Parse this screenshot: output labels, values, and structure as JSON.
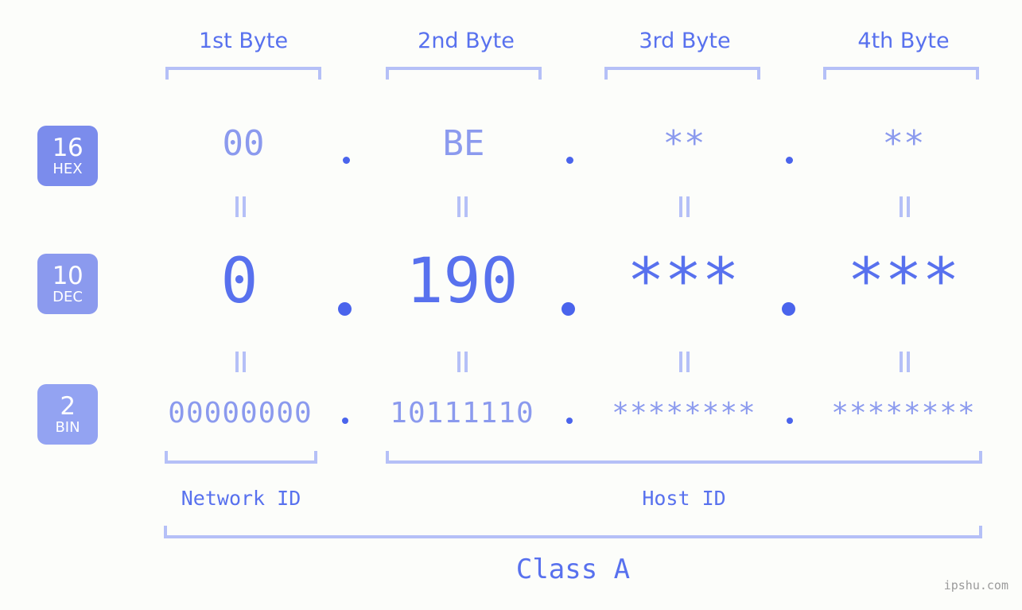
{
  "meta": {
    "watermark": "ipshu.com",
    "background_color": "#fcfdfa",
    "accent_strong": "#5871ee",
    "accent_light": "#8b9aee",
    "bracket_color": "#b5c0f7"
  },
  "byte_headers": [
    {
      "label": "1st Byte"
    },
    {
      "label": "2nd Byte"
    },
    {
      "label": "3rd Byte"
    },
    {
      "label": "4th Byte"
    }
  ],
  "bases": [
    {
      "number": "16",
      "name": "HEX",
      "color": "#7b8cec"
    },
    {
      "number": "10",
      "name": "DEC",
      "color": "#8b9aee"
    },
    {
      "number": "2",
      "name": "BIN",
      "color": "#93a3f2"
    }
  ],
  "rows": {
    "hex": {
      "values": [
        "00",
        "BE",
        "**",
        "**"
      ]
    },
    "dec": {
      "values": [
        "0",
        "190",
        "***",
        "***"
      ]
    },
    "bin": {
      "values": [
        "00000000",
        "10111110",
        "********",
        "********"
      ]
    }
  },
  "separator": ".",
  "equals_glyph": "=",
  "sections": [
    {
      "label": "Network ID"
    },
    {
      "label": "Host ID"
    }
  ],
  "class": {
    "label": "Class A"
  }
}
